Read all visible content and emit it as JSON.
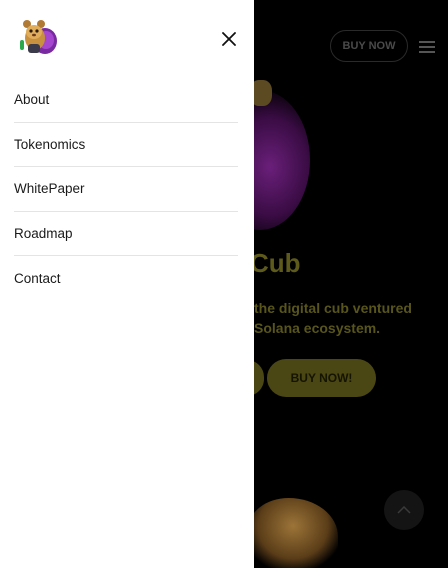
{
  "header": {
    "buy_button_label": "BUY NOW"
  },
  "hero": {
    "title_partial": "Cub",
    "description_lines": [
      "the digital cub ventured",
      "Solana ecosystem."
    ],
    "buy_now_label": "BUY NOW!"
  },
  "menu": {
    "items": [
      {
        "label": "About"
      },
      {
        "label": "Tokenomics"
      },
      {
        "label": "WhitePaper"
      },
      {
        "label": "Roadmap"
      },
      {
        "label": "Contact"
      }
    ]
  },
  "icons": {
    "logo": "cub-logo-icon",
    "close": "close-icon",
    "hamburger": "hamburger-icon",
    "scroll_top": "chevron-up-icon"
  },
  "colors": {
    "drawer_background": "#ffffff",
    "overlay_background": "#000000",
    "accent_dimmed": "#4a4714",
    "text": "#1a1a1a",
    "divider": "#e4e4e4"
  }
}
